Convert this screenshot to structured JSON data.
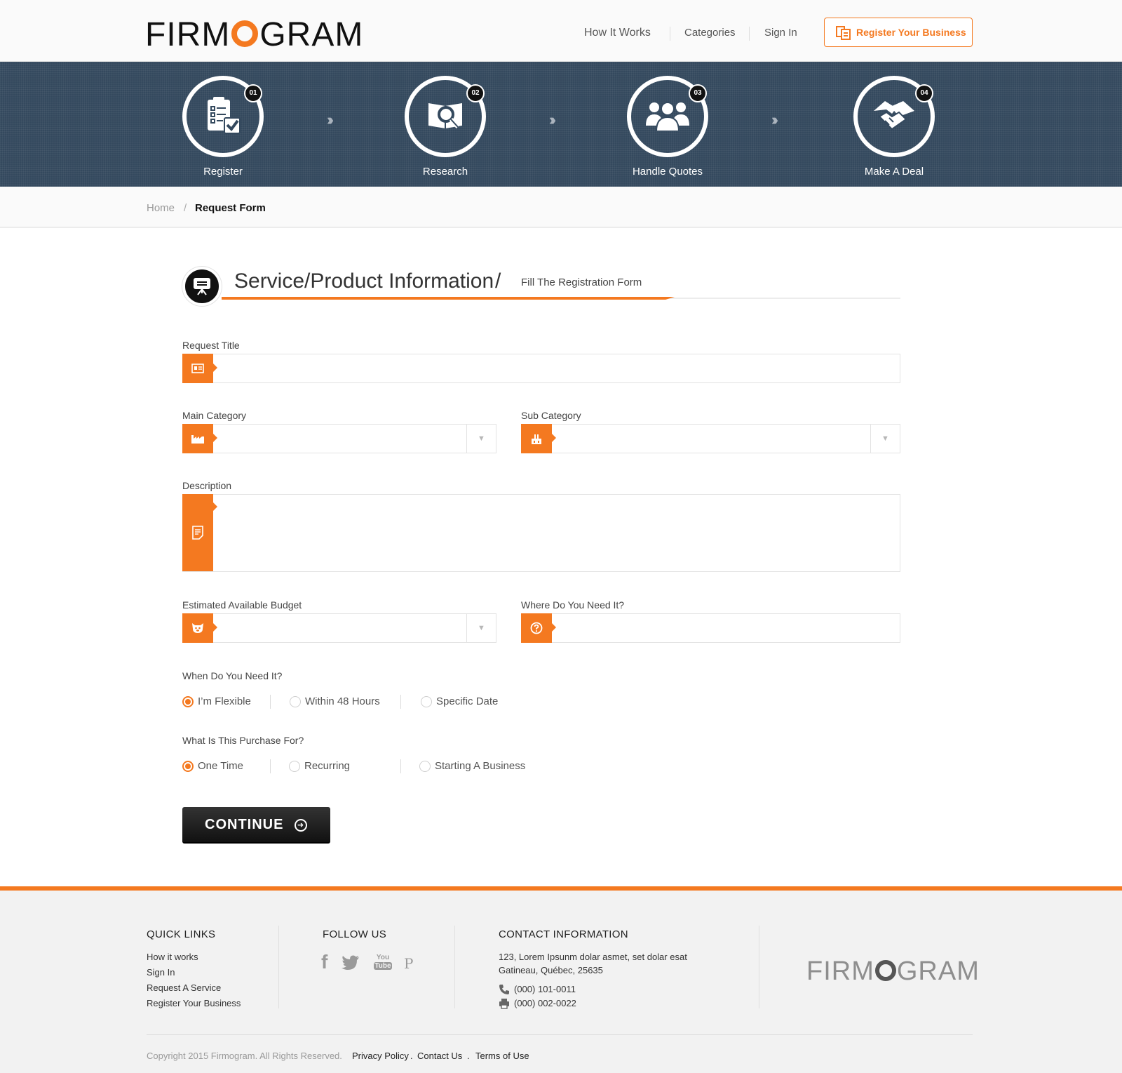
{
  "header": {
    "logo_left": "FIRM",
    "logo_right": "GRAM",
    "nav": [
      "How It Works",
      "Categories",
      "Sign In"
    ],
    "register_button": "Register Your Business"
  },
  "steps": [
    {
      "num": "01",
      "label": "Register"
    },
    {
      "num": "02",
      "label": "Research"
    },
    {
      "num": "03",
      "label": "Handle Quotes"
    },
    {
      "num": "04",
      "label": "Make A Deal"
    }
  ],
  "breadcrumb": {
    "home": "Home",
    "separator": "/",
    "current": "Request Form"
  },
  "section": {
    "title": "Service/Product Information",
    "slash": "/",
    "subtitle": "Fill The Registration Form"
  },
  "form": {
    "request_title_label": "Request Title",
    "main_category_label": "Main Category",
    "sub_category_label": "Sub Category",
    "description_label": "Description",
    "budget_label": "Estimated Available Budget",
    "where_label": "Where Do You Need It?",
    "when_label": "When Do You Need It?",
    "when_options": [
      "I’m Flexible",
      "Within 48 Hours",
      "Specific Date"
    ],
    "when_selected": "I’m Flexible",
    "purpose_label": "What Is This Purchase For?",
    "purpose_options": [
      "One Time",
      "Recurring",
      "Starting A Business"
    ],
    "purpose_selected": "One Time",
    "dropdown_arrow": "▼",
    "continue_label": "CONTINUE",
    "continue_arrow": "➜"
  },
  "footer": {
    "quick_links_title": "QUICK LINKS",
    "quick_links": [
      "How it works",
      "Sign In",
      "Request A Service",
      "Register Your Business"
    ],
    "follow_title": "FOLLOW US",
    "social": [
      "facebook-icon",
      "twitter-icon",
      "youtube-icon",
      "pinterest-icon"
    ],
    "social_glyphs": {
      "facebook": "f",
      "youtube_top": "You",
      "youtube_bottom": "Tube",
      "pinterest": "P"
    },
    "contact_title": "CONTACT INFORMATION",
    "address_line1": "123, Lorem Ipsunm dolar asmet, set dolar esat",
    "address_line2": "Gatineau, Québec, 25635",
    "phone": "(000) 101-0011",
    "fax": "(000) 002-0022",
    "logo_left": "FIRM",
    "logo_right": "GRAM",
    "copyright": "Copyright 2015  Firmogram.  All Rights Reserved.",
    "bottom_links": [
      "Privacy Policy",
      "Contact Us",
      "Terms of Use"
    ],
    "bottom_sep": "."
  },
  "colors": {
    "accent": "#f47920",
    "banner": "#34495e",
    "dark": "#111111"
  }
}
